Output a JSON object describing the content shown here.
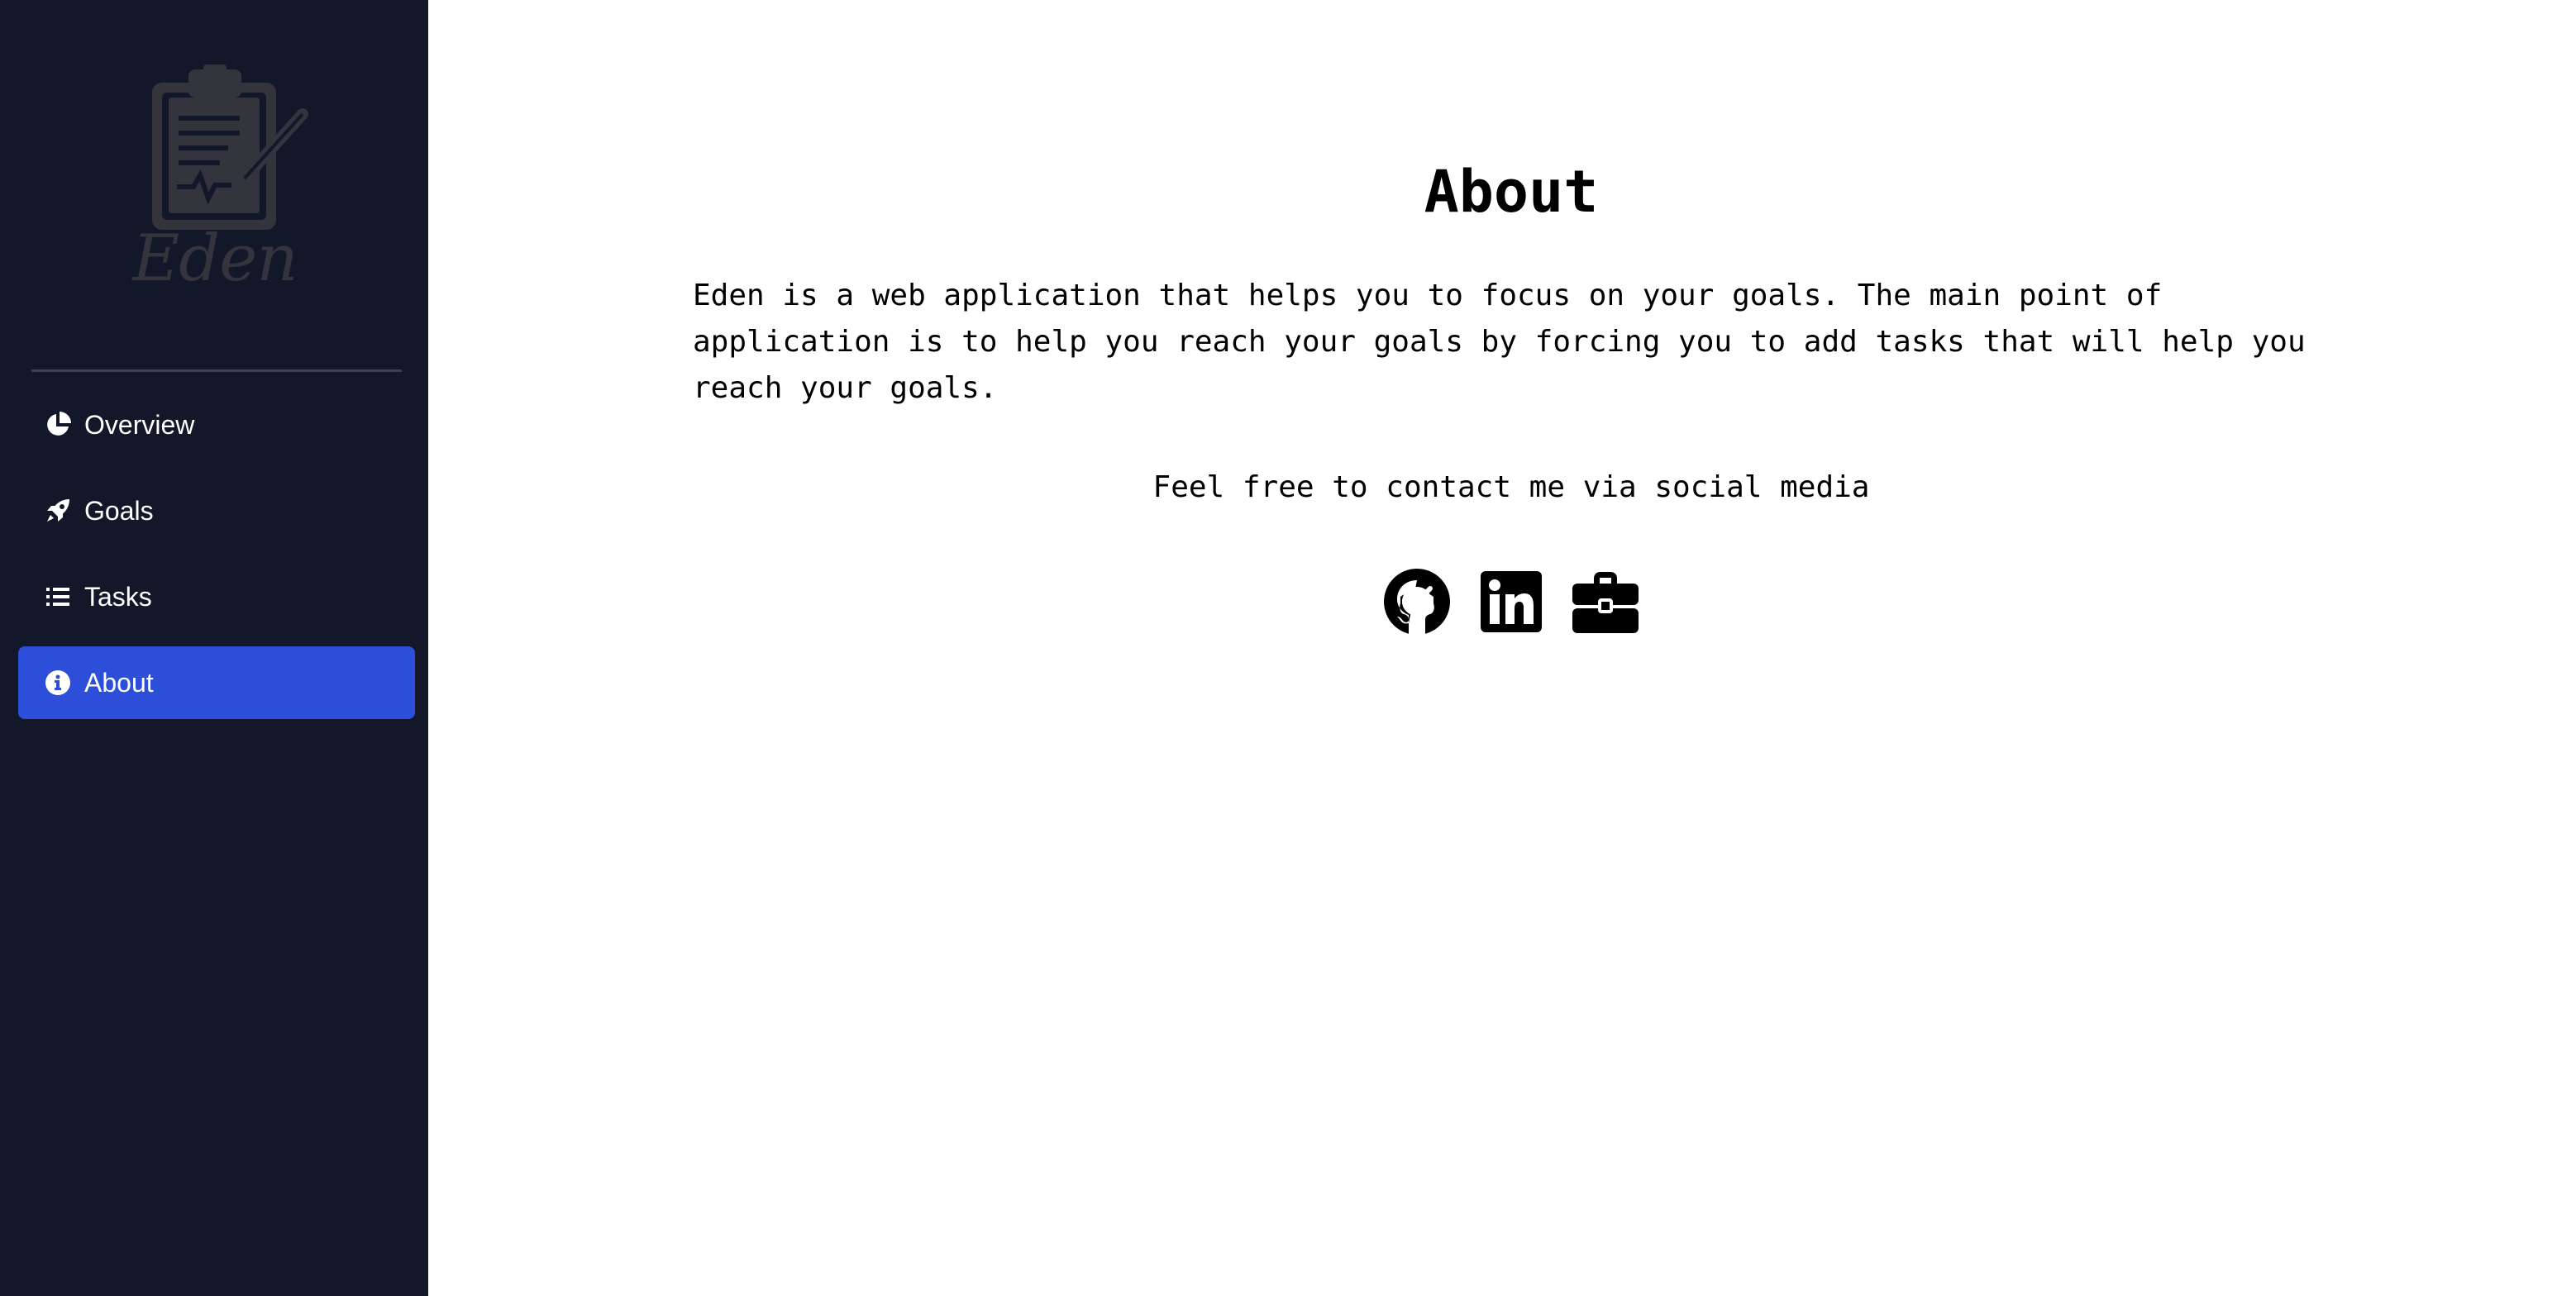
{
  "sidebar": {
    "brand": "Eden",
    "items": [
      {
        "label": "Overview",
        "icon": "pie-chart-icon"
      },
      {
        "label": "Goals",
        "icon": "rocket-icon"
      },
      {
        "label": "Tasks",
        "icon": "list-icon"
      },
      {
        "label": "About",
        "icon": "info-icon",
        "active": true
      }
    ]
  },
  "main": {
    "title": "About",
    "description": "Eden is a web application that helps you to focus on your goals. The main point of application is to help you reach your goals by forcing you to add tasks that will help you reach your goals.",
    "contact": "Feel free to contact me via social media",
    "socials": [
      {
        "icon": "github-icon"
      },
      {
        "icon": "linkedin-icon"
      },
      {
        "icon": "briefcase-icon"
      }
    ]
  },
  "colors": {
    "sidebar_bg": "#121829",
    "active_item": "#2c4ed8",
    "logo": "#34343c"
  }
}
